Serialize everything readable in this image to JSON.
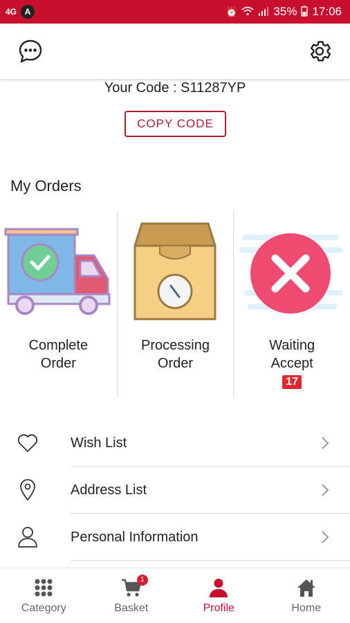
{
  "status_bar": {
    "network": "4G",
    "app_badge": "A",
    "battery": "35%",
    "time": "17:06"
  },
  "app_bar": {
    "left_icon": "chat-bubble-icon",
    "right_icon": "gear-icon"
  },
  "code": {
    "text": "Your Code : S11287YP",
    "copy_label": "COPY CODE"
  },
  "orders": {
    "title": "My Orders",
    "items": [
      {
        "line1": "Complete",
        "line2": "Order",
        "icon": "delivery-truck-icon"
      },
      {
        "line1": "Processing",
        "line2": "Order",
        "icon": "box-clock-icon"
      },
      {
        "line1": "Waiting",
        "line2": "Accept",
        "icon": "cancel-circle-icon",
        "badge": "17"
      }
    ]
  },
  "menu": {
    "items": [
      {
        "label": "Wish List",
        "icon": "heart-icon"
      },
      {
        "label": "Address List",
        "icon": "location-pin-icon"
      },
      {
        "label": "Personal Information",
        "icon": "person-icon"
      }
    ]
  },
  "bottom_nav": {
    "items": [
      {
        "label": "Category",
        "icon": "grid-icon"
      },
      {
        "label": "Basket",
        "icon": "cart-icon",
        "badge": "1"
      },
      {
        "label": "Profile",
        "icon": "person-filled-icon",
        "active": true
      },
      {
        "label": "Home",
        "icon": "home-icon"
      }
    ]
  },
  "colors": {
    "brand": "#c8102e",
    "badge": "#e0282e"
  }
}
